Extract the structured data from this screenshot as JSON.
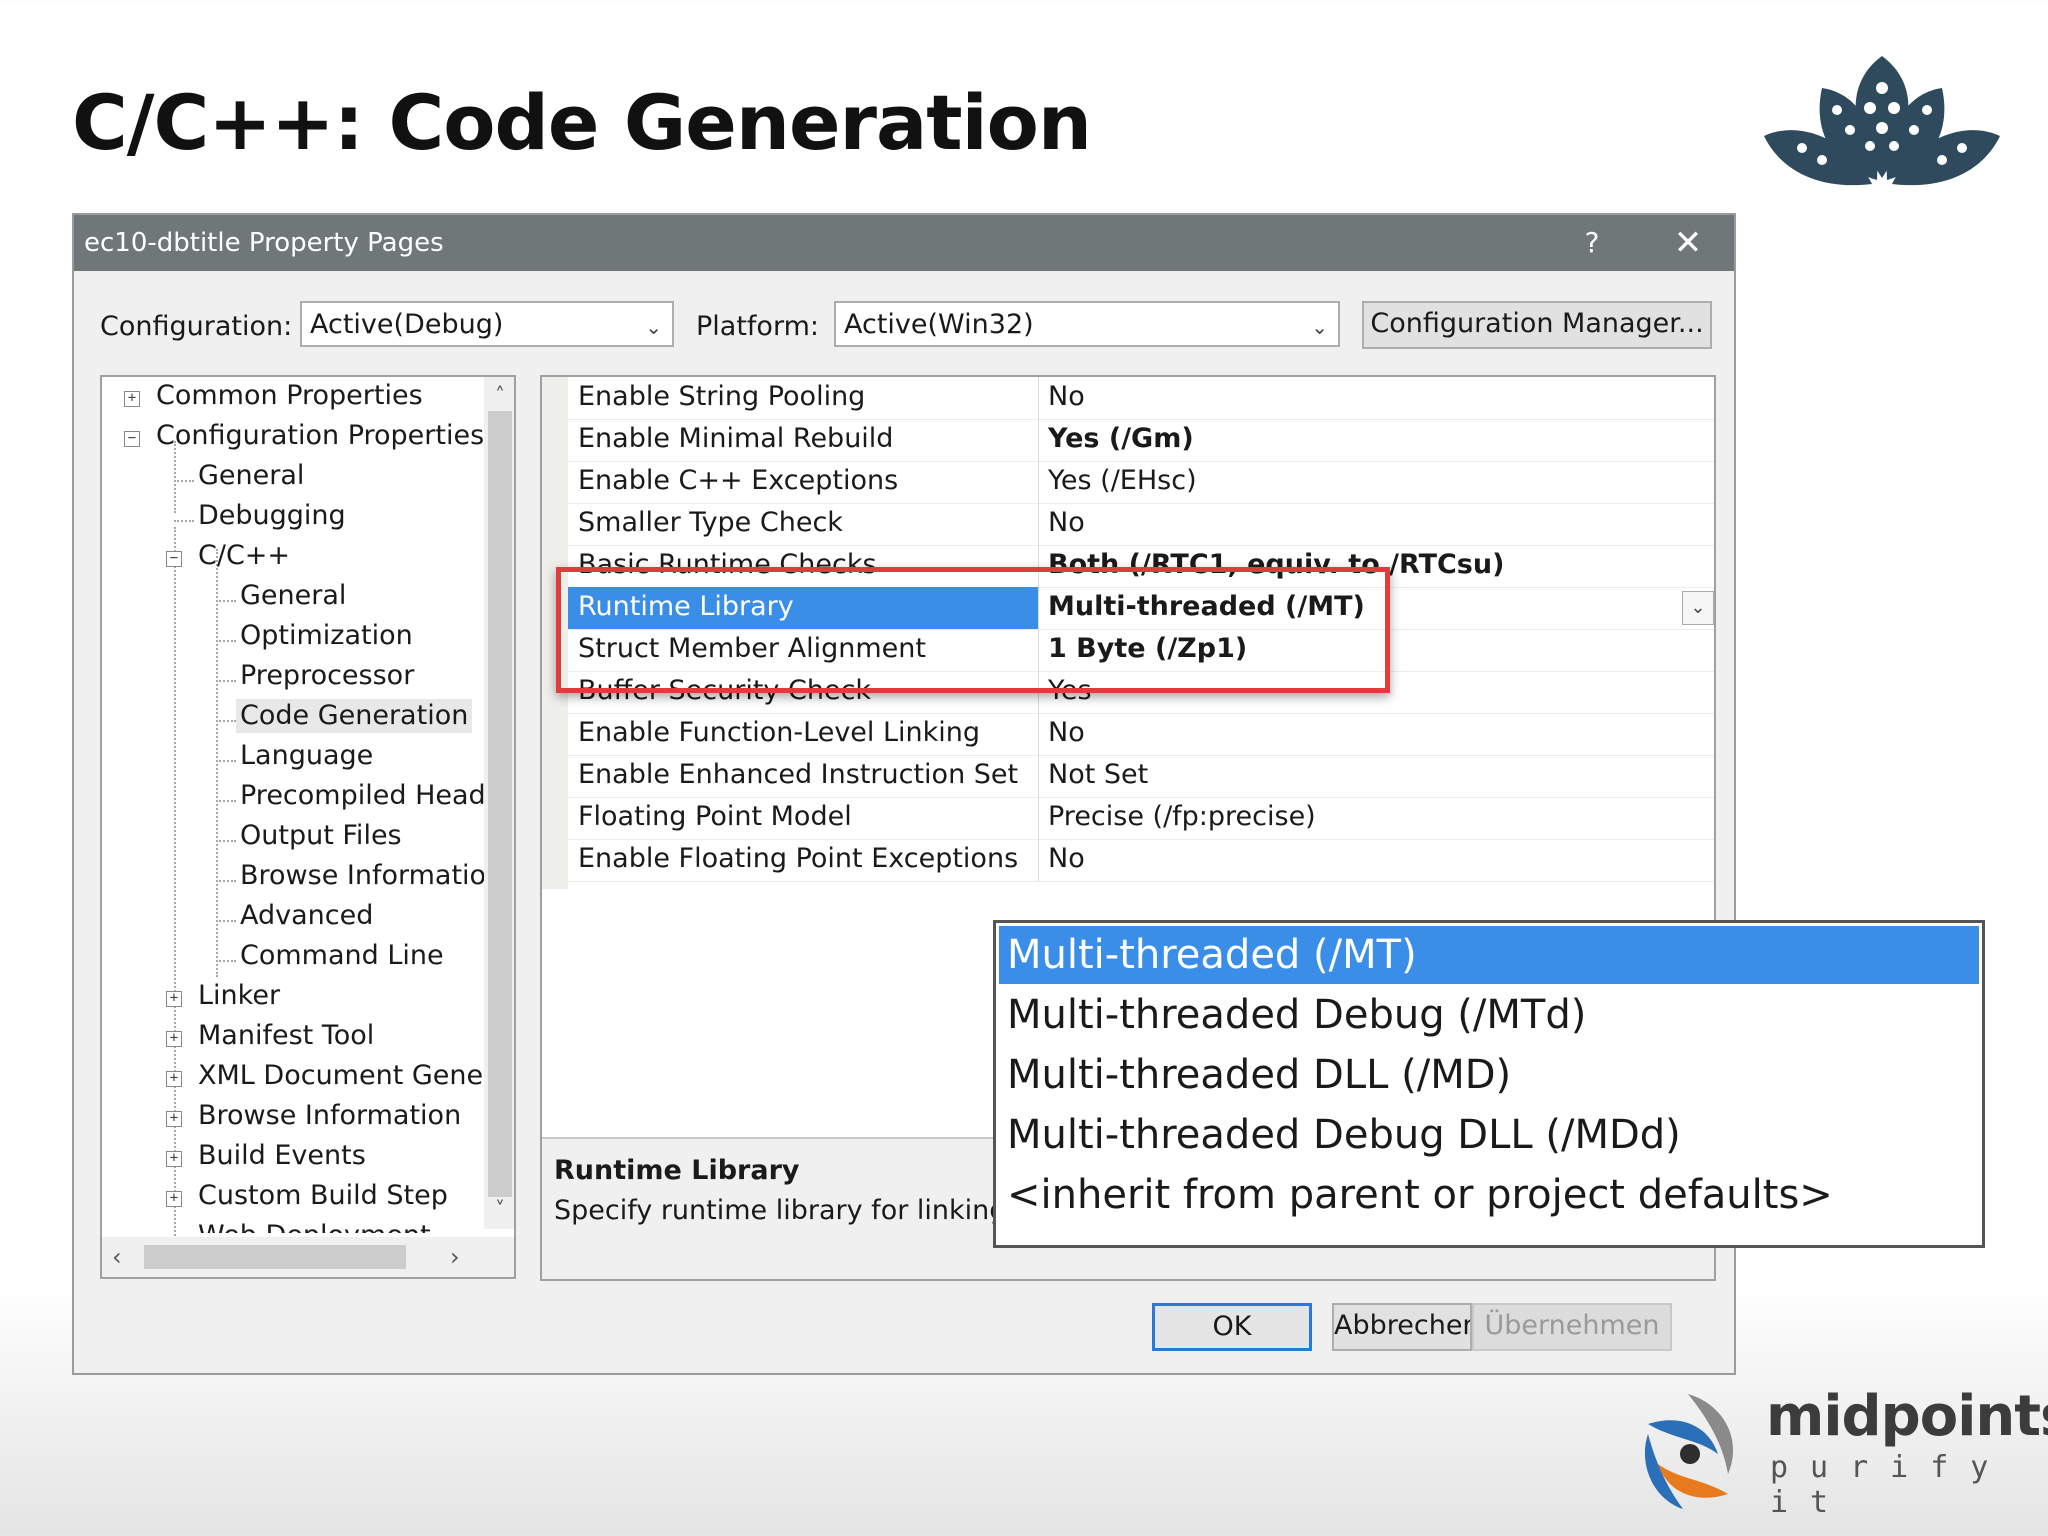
{
  "slide": {
    "title": "C/C++: Code Generation"
  },
  "dialog": {
    "title": "ec10-dbtitle Property Pages",
    "help_label": "?",
    "close_label": "✕",
    "configuration_label": "Configuration:",
    "configuration_value": "Active(Debug)",
    "platform_label": "Platform:",
    "platform_value": "Active(Win32)",
    "config_manager_label": "Configuration Manager...",
    "ok_label": "OK",
    "cancel_label": "Abbrechen",
    "apply_label": "Übernehmen"
  },
  "tree": [
    "Common Properties",
    "Configuration Properties",
    "General",
    "Debugging",
    "C/C++",
    "General",
    "Optimization",
    "Preprocessor",
    "Code Generation",
    "Language",
    "Precompiled Heade",
    "Output Files",
    "Browse Information",
    "Advanced",
    "Command Line",
    "Linker",
    "Manifest Tool",
    "XML Document Genera",
    "Browse Information",
    "Build Events",
    "Custom Build Step",
    "Web Deployment"
  ],
  "properties": [
    {
      "name": "Enable String Pooling",
      "value": "No"
    },
    {
      "name": "Enable Minimal Rebuild",
      "value": "Yes (/Gm)"
    },
    {
      "name": "Enable C++ Exceptions",
      "value": "Yes (/EHsc)"
    },
    {
      "name": "Smaller Type Check",
      "value": "No"
    },
    {
      "name": "Basic Runtime Checks",
      "value": "Both (/RTC1, equiv. to /RTCsu)"
    },
    {
      "name": "Runtime Library",
      "value": "Multi-threaded (/MT)"
    },
    {
      "name": "Struct Member Alignment",
      "value": "1 Byte (/Zp1)"
    },
    {
      "name": "Buffer Security Check",
      "value": "Yes"
    },
    {
      "name": "Enable Function-Level Linking",
      "value": "No"
    },
    {
      "name": "Enable Enhanced Instruction Set",
      "value": "Not Set"
    },
    {
      "name": "Floating Point Model",
      "value": "Precise (/fp:precise)"
    },
    {
      "name": "Enable Floating Point Exceptions",
      "value": "No"
    }
  ],
  "description": {
    "title": "Runtime Library",
    "text": "Specify runtime library for linking."
  },
  "dropdown_options": [
    "Multi-threaded (/MT)",
    "Multi-threaded Debug (/MTd)",
    "Multi-threaded DLL (/MD)",
    "Multi-threaded Debug DLL (/MDd)",
    "<inherit from parent or project defaults>"
  ],
  "brand": {
    "name": "midpoints",
    "tagline": "purify it"
  },
  "colors": {
    "selection": "#3b8ee8",
    "highlight_box": "#e03c3c",
    "logo_dark": "#2e4a5c",
    "titlebar": "#6f7778"
  }
}
